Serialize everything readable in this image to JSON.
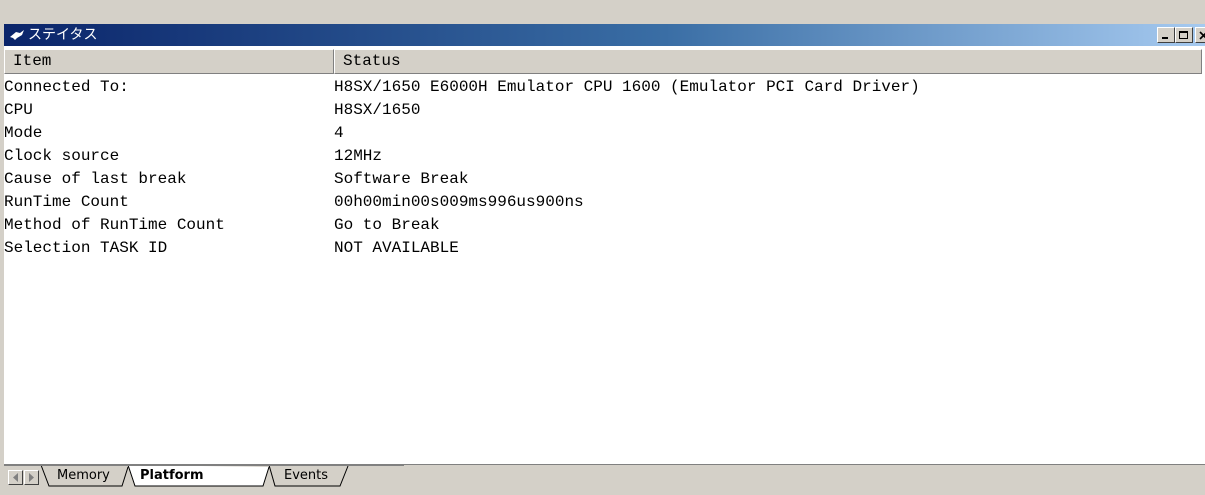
{
  "window": {
    "title": "ステイタス",
    "icon": "status-icon",
    "buttons": [
      "minimize",
      "maximize",
      "close"
    ]
  },
  "table": {
    "columns": [
      "Item",
      "Status"
    ],
    "rows": [
      {
        "item": "Connected To:",
        "status": "H8SX/1650 E6000H Emulator CPU 1600 (Emulator PCI Card Driver)"
      },
      {
        "item": "CPU",
        "status": "H8SX/1650"
      },
      {
        "item": "Mode",
        "status": "4"
      },
      {
        "item": "Clock source",
        "status": "12MHz"
      },
      {
        "item": "Cause of last break",
        "status": "Software Break"
      },
      {
        "item": "RunTime Count",
        "status": "00h00min00s009ms996us900ns"
      },
      {
        "item": "Method of RunTime Count",
        "status": "Go to Break"
      },
      {
        "item": "Selection TASK ID",
        "status": "NOT AVAILABLE"
      }
    ]
  },
  "tabs": [
    {
      "label": "Memory",
      "active": false
    },
    {
      "label": "Platform",
      "active": true
    },
    {
      "label": "Events",
      "active": false
    }
  ],
  "colors": {
    "titlebar_start": "#0a246a",
    "titlebar_end": "#a6caf0",
    "face": "#d4d0c8"
  }
}
